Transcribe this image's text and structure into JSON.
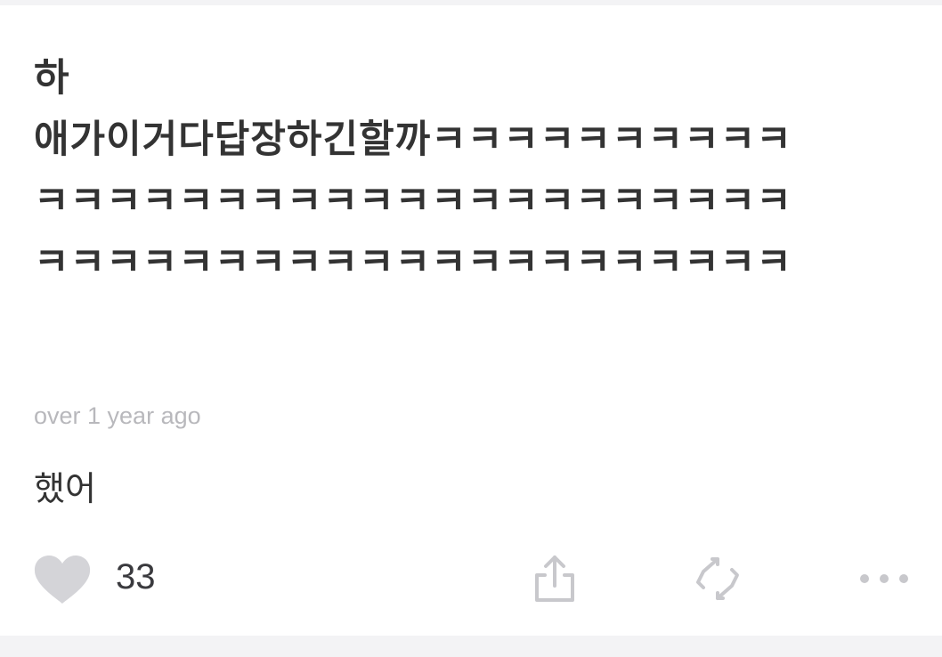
{
  "post": {
    "question": "하\n애가이거다답장하긴할까ㅋㅋㅋㅋㅋㅋㅋㅋㅋㅋㅋㅋㅋㅋㅋㅋㅋㅋㅋㅋㅋㅋㅋㅋㅋㅋㅋㅋㅋㅋㅋㅋㅋㅋㅋㅋㅋㅋㅋㅋㅋㅋㅋㅋㅋㅋㅋㅋㅋㅋㅋㅋ",
    "timestamp": "over 1 year ago",
    "answer": "했어"
  },
  "actions": {
    "like_count": "33",
    "like_icon": "heart-icon",
    "share_icon": "share-icon",
    "repost_icon": "repost-icon",
    "more_icon": "more-icon"
  },
  "colors": {
    "text_primary": "#333333",
    "text_muted": "#b8b8bc",
    "icon": "#c8c8cc",
    "background": "#f3f3f5",
    "card": "#ffffff"
  }
}
